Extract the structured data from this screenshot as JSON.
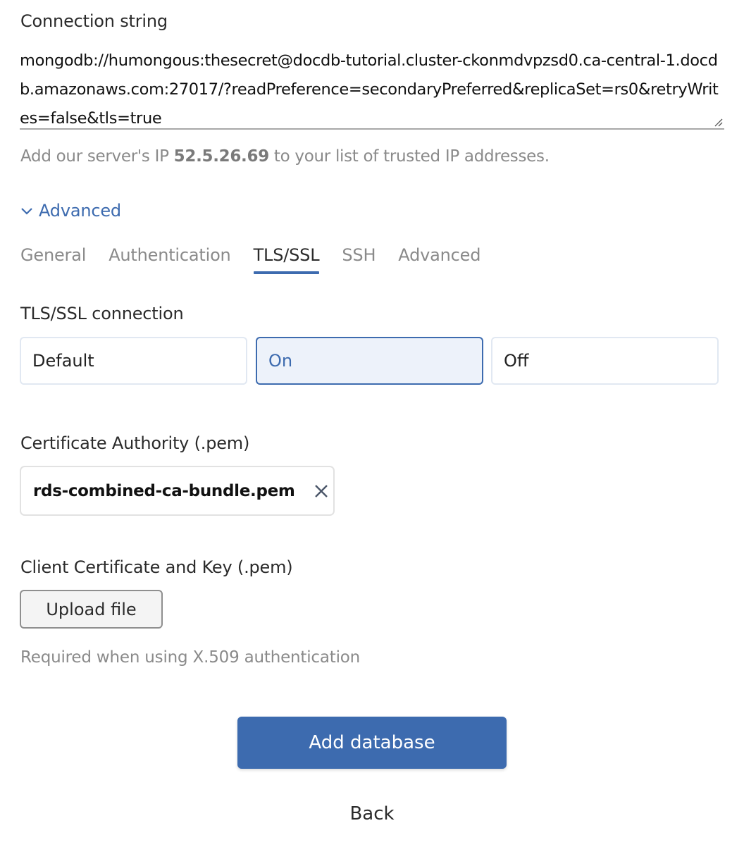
{
  "connection": {
    "label": "Connection string",
    "value": "mongodb://humongous:thesecret@docdb-tutorial.cluster-ckonmdvpzsd0.ca-central-1.docdb.amazonaws.com:27017/?readPreference=secondaryPreferred&replicaSet=rs0&retryWrites=false&tls=true",
    "resize_icon": "resize-handle-icon"
  },
  "ip_note": {
    "prefix": "Add our server's IP ",
    "ip": "52.5.26.69",
    "suffix": " to your list of trusted IP addresses."
  },
  "advanced_toggle": {
    "label": "Advanced",
    "icon": "chevron-down-icon",
    "expanded": true
  },
  "tabs": [
    {
      "label": "General",
      "active": false
    },
    {
      "label": "Authentication",
      "active": false
    },
    {
      "label": "TLS/SSL",
      "active": true
    },
    {
      "label": "SSH",
      "active": false
    },
    {
      "label": "Advanced",
      "active": false
    }
  ],
  "tls": {
    "label": "TLS/SSL connection",
    "options": [
      "Default",
      "On",
      "Off"
    ],
    "selected": "On"
  },
  "certificate_authority": {
    "label": "Certificate Authority (.pem)",
    "file_name": "rds-combined-ca-bundle.pem",
    "clear_icon": "close-icon"
  },
  "client_certificate": {
    "label": "Client Certificate and Key (.pem)",
    "upload_label": "Upload file",
    "hint": "Required when using X.509 authentication"
  },
  "actions": {
    "primary_label": "Add database",
    "back_label": "Back"
  },
  "colors": {
    "accent": "#3d6baf",
    "selected_bg": "#edf2fa",
    "muted_text": "#8a8a8a"
  }
}
